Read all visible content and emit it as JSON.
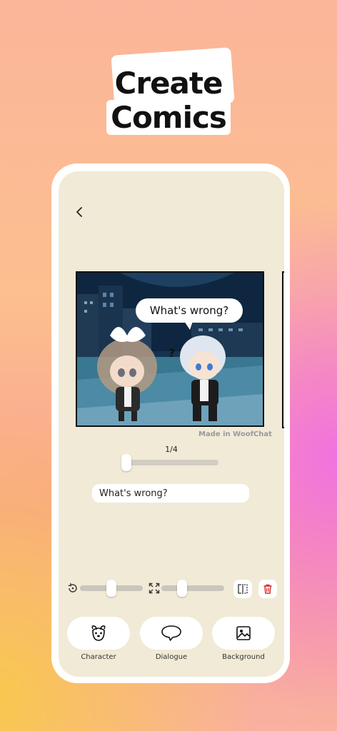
{
  "hero": {
    "line1": "Create",
    "line2": "Comics"
  },
  "editor": {
    "page_indicator": "1/4",
    "page_progress": 0.0,
    "watermark": "Made in WoofChat",
    "speech_bubble": "What's wrong?",
    "speech_mark": "?",
    "dialogue_input_value": "What's wrong?",
    "rotate_level": 0.5,
    "scale_level": 0.3
  },
  "tools": [
    {
      "label": "Character",
      "icon": "dog-face-icon"
    },
    {
      "label": "Dialogue",
      "icon": "speech-bubble-icon"
    },
    {
      "label": "Background",
      "icon": "image-icon"
    }
  ],
  "colors": {
    "screen_bg": "#f1ead7",
    "delete": "#d62828",
    "accent_pink": "#f172e0",
    "accent_yellow": "#f9c74f"
  }
}
